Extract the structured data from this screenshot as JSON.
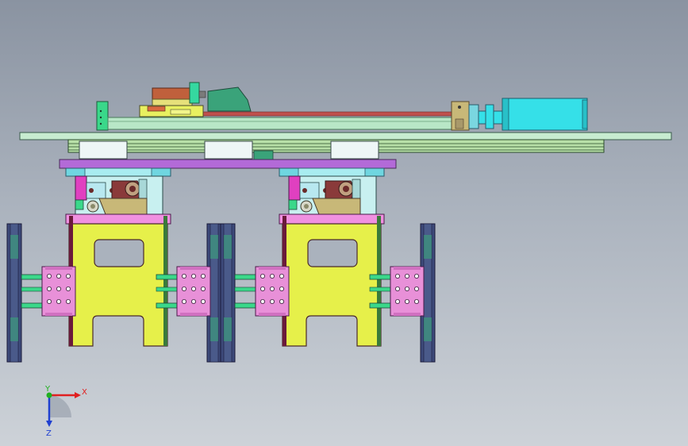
{
  "axes": {
    "x_label": "X",
    "y_label": "Y",
    "z_label": "Z",
    "colors": {
      "x": "#e02020",
      "y": "#20b020",
      "z": "#2040d0"
    }
  },
  "palette": {
    "background_top": "#8a93a1",
    "base_plate": "#c7ecd0",
    "rail": "#b8e7c7",
    "lead_screw": "#c0504d",
    "motor": "#35e0e8",
    "carriage_red": "#c0503c",
    "gusset": "#3aa37a",
    "slide_purple": "#b36ad8",
    "slide_cyan": "#6fd6e0",
    "gripper_yellow": "#e6f04a",
    "gripper_outline": "#4a2a2a",
    "gripper_top_pink": "#f090e0",
    "wheel_dark": "#3d4a7a",
    "cylinder_pink": "#e890d8",
    "rod_green": "#3ad88a",
    "bracket_tan": "#c8b878",
    "magenta": "#e040c0"
  }
}
